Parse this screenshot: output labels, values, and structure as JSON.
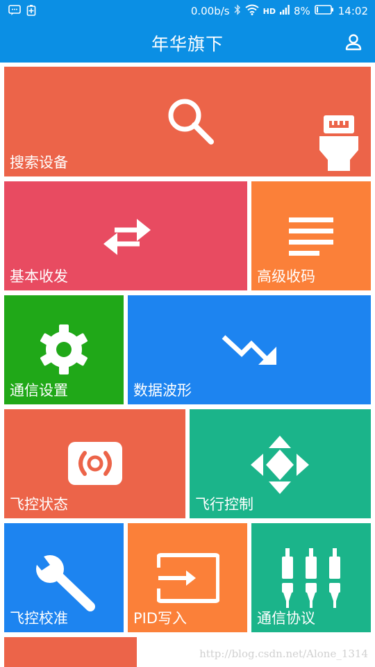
{
  "status_bar": {
    "speed": "0.00b/s",
    "network": "HD",
    "battery": "8%",
    "time": "14:02"
  },
  "app_bar": {
    "title": "年华旗下"
  },
  "tiles": [
    {
      "label": "搜索设备",
      "color": "#ec6449",
      "icon": "search-icon"
    },
    {
      "label": "基本收发",
      "color": "#e84b61",
      "icon": "swap-arrows-icon"
    },
    {
      "label": "高级收码",
      "color": "#fb8039",
      "icon": "lines-icon"
    },
    {
      "label": "通信设置",
      "color": "#20a818",
      "icon": "gear-icon"
    },
    {
      "label": "数据波形",
      "color": "#1d84f0",
      "icon": "trend-down-icon"
    },
    {
      "label": "飞控状态",
      "color": "#ec6449",
      "icon": "signal-icon"
    },
    {
      "label": "飞行控制",
      "color": "#1bb48a",
      "icon": "move-arrows-icon"
    },
    {
      "label": "飞控校准",
      "color": "#1d84f0",
      "icon": "wrench-icon"
    },
    {
      "label": "PID写入",
      "color": "#fb8039",
      "icon": "input-icon"
    },
    {
      "label": "通信协议",
      "color": "#1bb48a",
      "icon": "plugs-icon"
    },
    {
      "label": "",
      "color": "#ec6449",
      "icon": ""
    }
  ],
  "watermark": "http://blog.csdn.net/Alone_1314"
}
